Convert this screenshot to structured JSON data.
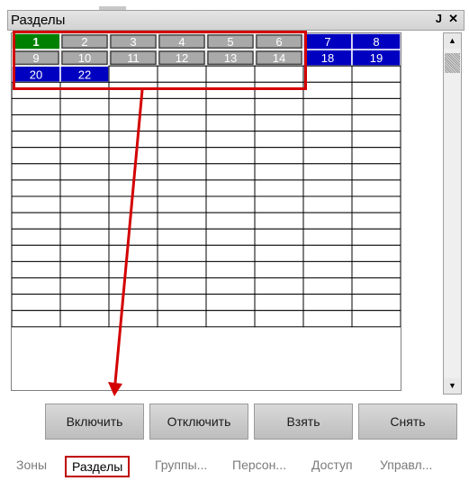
{
  "panel": {
    "title": "Разделы",
    "pin_glyph": "ф",
    "close_glyph": "✕"
  },
  "grid": {
    "rows": [
      [
        {
          "label": "1",
          "state": "green"
        },
        {
          "label": "2",
          "state": "gray"
        },
        {
          "label": "3",
          "state": "gray"
        },
        {
          "label": "4",
          "state": "gray"
        },
        {
          "label": "5",
          "state": "gray"
        },
        {
          "label": "6",
          "state": "gray"
        },
        {
          "label": "7",
          "state": "blue"
        },
        {
          "label": "8",
          "state": "blue"
        }
      ],
      [
        {
          "label": "9",
          "state": "gray"
        },
        {
          "label": "10",
          "state": "gray"
        },
        {
          "label": "11",
          "state": "gray"
        },
        {
          "label": "12",
          "state": "gray"
        },
        {
          "label": "13",
          "state": "gray"
        },
        {
          "label": "14",
          "state": "gray"
        },
        {
          "label": "18",
          "state": "blue"
        },
        {
          "label": "19",
          "state": "blue"
        }
      ],
      [
        {
          "label": "20",
          "state": "blue"
        },
        {
          "label": "22",
          "state": "blue"
        },
        {
          "label": "",
          "state": "empty"
        },
        {
          "label": "",
          "state": "empty"
        },
        {
          "label": "",
          "state": "empty"
        },
        {
          "label": "",
          "state": "empty"
        },
        {
          "label": "",
          "state": "empty"
        },
        {
          "label": "",
          "state": "empty"
        }
      ]
    ],
    "empty_rows": 15,
    "colors": {
      "green": "#008000",
      "gray": "#a9a9a9",
      "blue": "#0000c0",
      "empty": "#ffffff"
    }
  },
  "buttons": {
    "enable": "Включить",
    "disable": "Отключить",
    "arm": "Взять",
    "disarm": "Снять"
  },
  "tabs": [
    {
      "label": "Зоны",
      "active": false
    },
    {
      "label": "Разделы",
      "active": true
    },
    {
      "label": "Группы...",
      "active": false
    },
    {
      "label": "Персон...",
      "active": false
    },
    {
      "label": "Доступ",
      "active": false
    },
    {
      "label": "Управл...",
      "active": false
    }
  ],
  "annotation_color": "#d40000"
}
